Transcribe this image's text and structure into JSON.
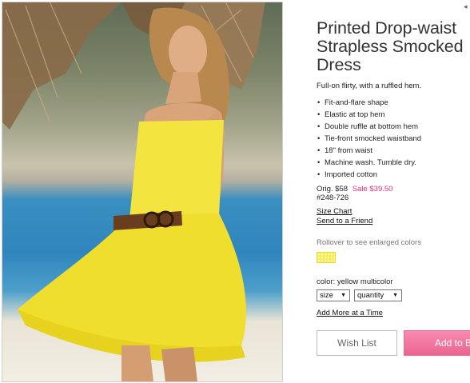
{
  "photo": {
    "icon": "product-photo",
    "colors": {
      "dress": "#f3e440",
      "ocean": "#2f86bd",
      "sand": "#f0ebe0",
      "belt": "#6a3d1e",
      "skin": "#d9a47a"
    }
  },
  "product": {
    "title": "Printed Drop-waist\nStrapless Smocked\nDress",
    "description": "Full-on flirty, with a ruffled hem.",
    "features": [
      "Fit-and-flare shape",
      "Elastic at top hem",
      "Double ruffle at bottom hem",
      "Tie-front smocked waistband",
      "18\" from waist",
      "Machine wash. Tumble dry.",
      "Imported cotton"
    ],
    "price": {
      "original": "Orig. $58",
      "sale": "Sale $39.50",
      "sale_color": "#d6337a"
    },
    "sku": "#248-726"
  },
  "links": {
    "size_chart": "Size Chart",
    "send_to_friend": "Send to a Friend",
    "add_more": "Add More at a Time"
  },
  "colors": {
    "rollover_text": "Rollover to see enlarged colors",
    "swatch_color": "#f6ec55",
    "selected_label": "color: yellow multicolor"
  },
  "selects": {
    "size": "size",
    "quantity": "quantity"
  },
  "buttons": {
    "wish_list": "Wish List",
    "add_to_bag": "Add to B",
    "add_color": "#ea6491"
  }
}
